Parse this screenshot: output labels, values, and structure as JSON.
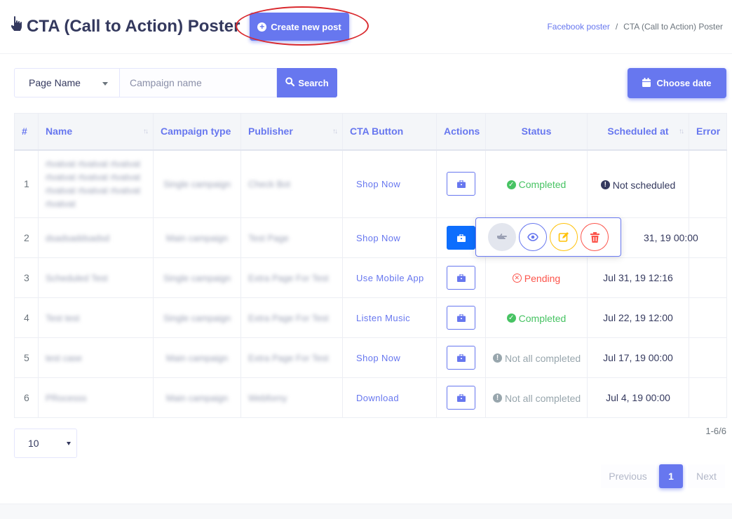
{
  "header": {
    "title": "CTA (Call to Action) Poster",
    "create_button": "Create new post",
    "breadcrumb": [
      {
        "label": "Facebook poster"
      },
      {
        "label": "CTA (Call to Action) Poster"
      }
    ]
  },
  "filters": {
    "page_select_value": "Page Name",
    "campaign_placeholder": "Campaign name",
    "search_button": "Search",
    "date_button": "Choose date"
  },
  "table": {
    "columns": [
      "#",
      "Name",
      "Campaign type",
      "Publisher",
      "CTA Button",
      "Actions",
      "Status",
      "Scheduled at",
      "Error"
    ],
    "rows": [
      {
        "num": "1",
        "name": "rtvatvat rtvatvat rtvatvat rtvatvat rtvatvat rtvatvat rtvatvat rtvatvat rtvatvat rtvatvat",
        "type": "Single campaign",
        "publisher": "Check Bot",
        "cta": "Shop Now",
        "status": "Completed",
        "status_kind": "completed",
        "scheduled": "Not scheduled",
        "error": ""
      },
      {
        "num": "2",
        "name": "dsadsaddsadsd",
        "type": "Main campaign",
        "publisher": "Test Page",
        "cta": "Shop Now",
        "status": "",
        "status_kind": "",
        "scheduled": "31, 19 00:00",
        "error": ""
      },
      {
        "num": "3",
        "name": "Scheduled Test",
        "type": "Single campaign",
        "publisher": "Extra Page For Test",
        "cta": "Use Mobile App",
        "status": "Pending",
        "status_kind": "pending",
        "scheduled": "Jul 31, 19 12:16",
        "error": ""
      },
      {
        "num": "4",
        "name": "Test test",
        "type": "Single campaign",
        "publisher": "Extra Page For Test",
        "cta": "Listen Music",
        "status": "Completed",
        "status_kind": "completed",
        "scheduled": "Jul 22, 19 12:00",
        "error": ""
      },
      {
        "num": "5",
        "name": "test case",
        "type": "Main campaign",
        "publisher": "Extra Page For Test",
        "cta": "Shop Now",
        "status": "Not all completed",
        "status_kind": "notall",
        "scheduled": "Jul 17, 19 00:00",
        "error": ""
      },
      {
        "num": "6",
        "name": "PRocesss",
        "type": "Main campaign",
        "publisher": "Webforny",
        "cta": "Download",
        "status": "Not all completed",
        "status_kind": "notall",
        "scheduled": "Jul 4, 19 00:00",
        "error": ""
      }
    ]
  },
  "pagination": {
    "per_page": "10",
    "count": "1-6/6",
    "previous": "Previous",
    "current": "1",
    "next": "Next"
  },
  "colors": {
    "primary": "#6777ef",
    "success": "#47c363",
    "danger": "#fc544b",
    "warning": "#ffc107",
    "muted": "#98a6ad",
    "highlight": "#d9292e"
  },
  "icons": {
    "title": "hand-pointer-icon",
    "actions": "briefcase-icon",
    "popover": [
      "hand-point-right-icon",
      "eye-icon",
      "edit-icon",
      "trash-icon"
    ]
  }
}
